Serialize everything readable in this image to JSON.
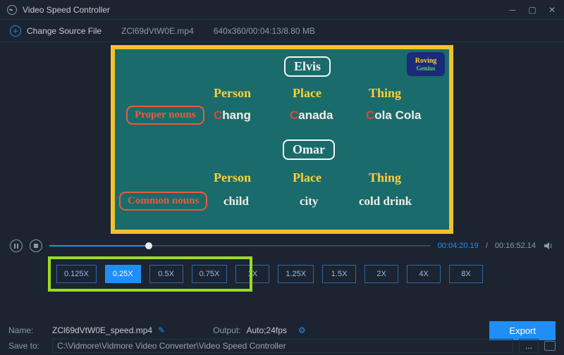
{
  "title": "Video Speed Controller",
  "toolbar": {
    "change_source": "Change Source File",
    "filename": "ZCl69dVtW0E.mp4",
    "meta": "640x360/00:04:13/8.80 MB"
  },
  "preview": {
    "badge_top": "Roving",
    "badge_bottom": "Genius",
    "name1": "Elvis",
    "name2": "Omar",
    "label_proper": "Proper nouns",
    "label_common": "Common nouns",
    "col_person": "Person",
    "col_place": "Place",
    "col_thing": "Thing",
    "r1c1": "hang",
    "r1c1_i": "C",
    "r1c2": "anada",
    "r1c2_i": "C",
    "r1c3": "ola Cola",
    "r1c3_i": "C",
    "r2c1": "child",
    "r2c2": "city",
    "r2c3": "cold drink"
  },
  "playback": {
    "current": "00:04:20.19",
    "total": "00:16:52.14"
  },
  "speeds": [
    "0.125X",
    "0.25X",
    "0.5X",
    "0.75X",
    "1X",
    "1.25X",
    "1.5X",
    "2X",
    "4X",
    "8X"
  ],
  "speed_selected_index": 1,
  "bottom": {
    "name_label": "Name:",
    "name_value": "ZCl69dVtW0E_speed.mp4",
    "output_label": "Output:",
    "output_value": "Auto;24fps",
    "saveto_label": "Save to:",
    "saveto_path": "C:\\Vidmore\\Vidmore Video Converter\\Video Speed Controller",
    "browse": "...",
    "export": "Export"
  }
}
